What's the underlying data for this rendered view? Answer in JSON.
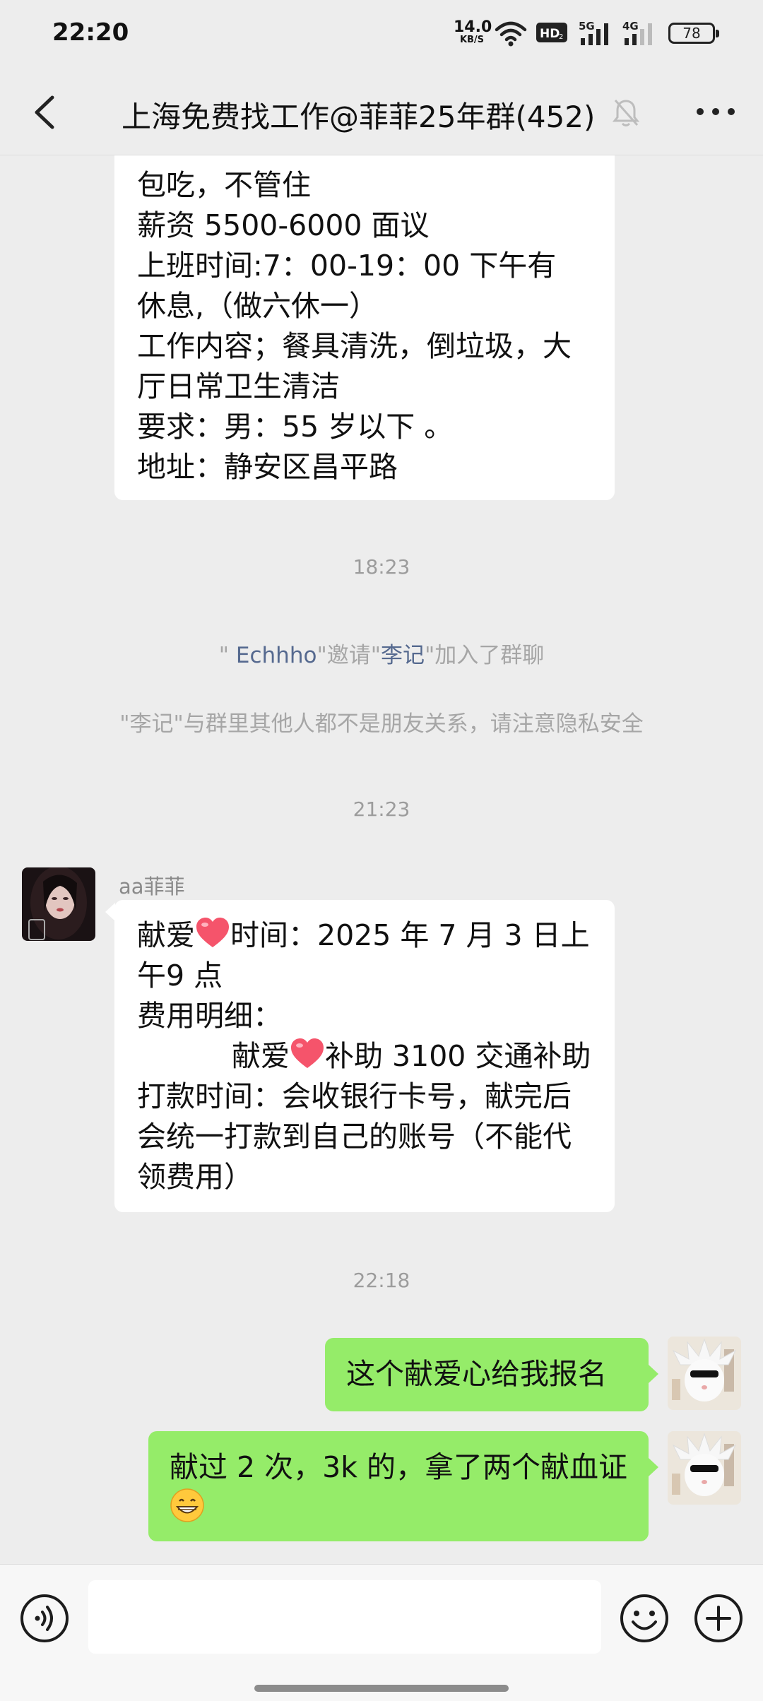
{
  "status_bar": {
    "time": "22:20",
    "net_speed_value": "14.0",
    "net_speed_unit": "KB/S",
    "hd_label": "HD",
    "signal_1": "5G",
    "signal_2": "4G",
    "battery": "78"
  },
  "header": {
    "title": "上海免费找工作@菲菲25年群(452)"
  },
  "messages": {
    "job_post": {
      "lines": [
        "包吃，不管住",
        "薪资 5500-6000 面议",
        "上班时间:7：00-19：00   下午有",
        "休息,（做六休一）",
        "工作内容；餐具清洗，倒垃圾，大",
        "厅日常卫生清洁",
        "要求：男：55 岁以下 。",
        "地址：静安区昌平路"
      ]
    },
    "time_1": "18:23",
    "system_invite": {
      "prefix": "\"   ",
      "inviter": "Echhho",
      "mid": "\"邀请\"",
      "invitee": "李记",
      "suffix": "\"加入了群聊"
    },
    "system_privacy": "\"李记\"与群里其他人都不是朋友关系，请注意隐私安全",
    "time_2": "21:23",
    "sender_name": "aa菲菲",
    "donation_post": {
      "line1_a": "献爱",
      "line1_b": "时间：2025 年 7 月 3 日上",
      "line2": "午9 点",
      "line3": "费用明细：",
      "line4_a": "献爱",
      "line4_b": "补助 3100 交通补助",
      "line5": "打款时间：会收银行卡号，献完后",
      "line6": "会统一打款到自己的账号（不能代",
      "line7": "领费用）"
    },
    "time_3": "22:18",
    "my_msg_1": "这个献爱心给我报名",
    "my_msg_2": "献过 2 次，3k 的，拿了两个献血证"
  },
  "input_bar": {
    "placeholder": ""
  },
  "colors": {
    "background": "#ededed",
    "my_bubble": "#95ec69",
    "their_bubble": "#ffffff",
    "link_name": "#55698f"
  }
}
